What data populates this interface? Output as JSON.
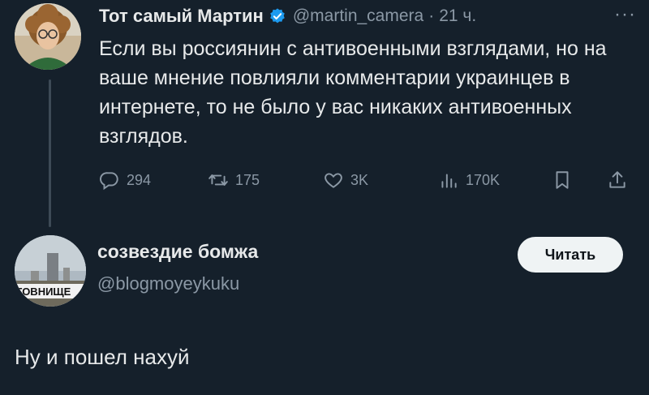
{
  "tweet1": {
    "author_name": "Тот самый Мартин",
    "handle": "@martin_camera",
    "separator": "·",
    "time": "21 ч.",
    "more": "···",
    "text": "Если вы россиянин с антивоенными взглядами, но на ваше мнение повлияли комментарии украинцев в интернете, то не было у вас никаких антивоенных взглядов.",
    "actions": {
      "replies": "294",
      "retweets": "175",
      "likes": "3K",
      "views": "170K"
    }
  },
  "tweet2": {
    "author_name": "созвездие бомжа",
    "handle": "@blogmoyeykuku",
    "follow_label": "Читать",
    "avatar_text": "ГОВНИЩЕ",
    "text": "Ну и пошел нахуй"
  },
  "colors": {
    "background": "#15202b",
    "primary_text": "#e7e9ea",
    "secondary_text": "#8b98a5",
    "verified_blue": "#1d9bf0",
    "button_bg": "#eff3f4"
  },
  "icons": [
    "verified-badge-icon",
    "reply-icon",
    "retweet-icon",
    "like-icon",
    "views-icon",
    "bookmark-icon",
    "share-icon",
    "more-icon"
  ]
}
